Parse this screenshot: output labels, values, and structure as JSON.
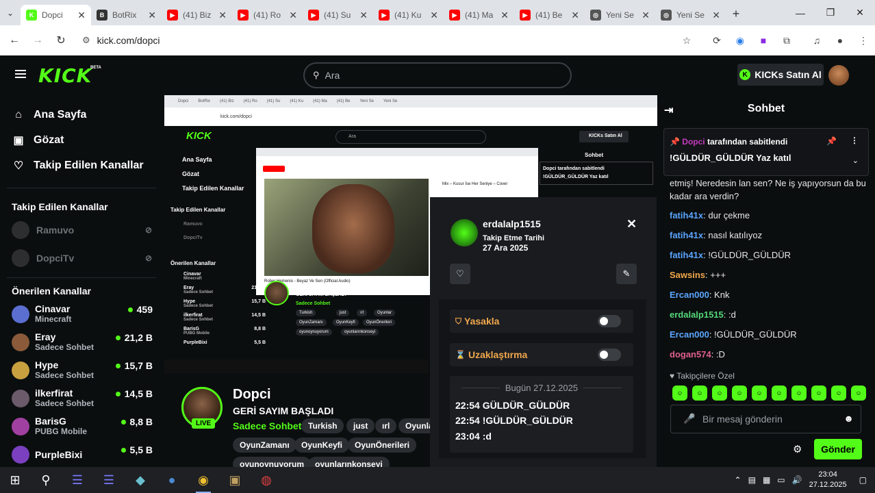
{
  "browser": {
    "tabs": [
      {
        "label": "Dopci",
        "fav_color": "#53fc18",
        "fav_text": "K",
        "active": true
      },
      {
        "label": "BotRix",
        "fav_color": "#333",
        "fav_text": "B"
      },
      {
        "label": "(41) Biz",
        "fav_color": "#ff0000",
        "fav_text": "▶"
      },
      {
        "label": "(41) Ro",
        "fav_color": "#ff0000",
        "fav_text": "▶"
      },
      {
        "label": "(41) Su",
        "fav_color": "#ff0000",
        "fav_text": "▶"
      },
      {
        "label": "(41) Ku",
        "fav_color": "#ff0000",
        "fav_text": "▶"
      },
      {
        "label": "(41) Ma",
        "fav_color": "#ff0000",
        "fav_text": "▶"
      },
      {
        "label": "(41) Be",
        "fav_color": "#ff0000",
        "fav_text": "▶"
      },
      {
        "label": "Yeni Se",
        "fav_color": "#555",
        "fav_text": "◎"
      },
      {
        "label": "Yeni Se",
        "fav_color": "#555",
        "fav_text": "◎"
      }
    ],
    "url": "kick.com/dopci"
  },
  "header": {
    "search_placeholder": "Ara",
    "kicks_button": "KICKs Satın Al",
    "beta_label": "BETA",
    "logo_text": "KICK"
  },
  "sidebar": {
    "nav": [
      {
        "label": "Ana Sayfa",
        "icon": "⌂"
      },
      {
        "label": "Gözat",
        "icon": "▣"
      },
      {
        "label": "Takip Edilen Kanallar",
        "icon": "♡"
      }
    ],
    "followed_heading": "Takip Edilen Kanallar",
    "followed": [
      {
        "name": "Ramuvo"
      },
      {
        "name": "DopciTv"
      }
    ],
    "recommended_heading": "Önerilen Kanallar",
    "recommended": [
      {
        "name": "Cinavar",
        "category": "Minecraft",
        "viewers": "459",
        "color": "#5b6fd1"
      },
      {
        "name": "Eray",
        "category": "Sadece Sohbet",
        "viewers": "21,2 B",
        "color": "#8a5a3a"
      },
      {
        "name": "Hype",
        "category": "Sadece Sohbet",
        "viewers": "15,7 B",
        "color": "#c8a040"
      },
      {
        "name": "ilkerfirat",
        "category": "Sadece Sohbet",
        "viewers": "14,5 B",
        "color": "#6a5a6a"
      },
      {
        "name": "BarisG",
        "category": "PUBG Mobile",
        "viewers": "8,8 B",
        "color": "#a040a0"
      },
      {
        "name": "PurpleBixi",
        "category": "",
        "viewers": "5,5 B",
        "color": "#7a40c0"
      }
    ]
  },
  "stream_mirror": {
    "url": "kick.com/dopci",
    "search": "Ara",
    "kicks": "KICKs Satın Al",
    "chat_title": "Sohbet",
    "pinned_user": "Dopci tarafından sabitlendi",
    "pinned_text": "!GÜLDÜR_GÜLDÜR Yaz katıl",
    "video_title": "Rober Hemenio - Beyaz Ve Sen (Official Audio)",
    "nav": [
      "Ana Sayfa",
      "Gözat",
      "Takip Edilen Kanallar"
    ],
    "followed_heading": "Takip Edilen Kanallar",
    "followed": [
      "Ramuvo",
      "DopciTv"
    ],
    "recommended_heading": "Önerilen Kanallar",
    "recommended": [
      {
        "name": "Cinavar",
        "category": "Minecraft",
        "viewers": "459"
      },
      {
        "name": "Eray",
        "category": "Sadece Sohbet",
        "viewers": "21,2 B"
      },
      {
        "name": "Hype",
        "category": "Sadece Sohbet",
        "viewers": "15,7 B"
      },
      {
        "name": "ilkerfirat",
        "category": "Sadece Sohbet",
        "viewers": "14,5 B"
      },
      {
        "name": "BarisG",
        "category": "PUBG Mobile",
        "viewers": "8,8 B"
      },
      {
        "name": "PurpleBixi",
        "category": "",
        "viewers": "5,5 B"
      }
    ],
    "streamer": "Dopci",
    "stream_title": "GERİ SAYIM BAŞLADI",
    "category": "Sadece Sohbet",
    "tags": [
      "Turkish",
      "just",
      "ırl",
      "Oyunlar",
      "OyunZamanı",
      "OyunKeyfi",
      "OyunÖnerileri",
      "oyunoynuyorum",
      "oyunlarınkonseyi"
    ]
  },
  "stream_info": {
    "streamer": "Dopci",
    "title": "GERİ SAYIM BAŞLADI",
    "category": "Sadece Sohbet",
    "live": "LIVE",
    "tags": [
      "Turkish",
      "just",
      "ırl",
      "Oyunlar",
      "OyunZamanı",
      "OyunKeyfi",
      "OyunÖnerileri",
      "oyunoynuyorum",
      "oyunlarınkonseyi"
    ]
  },
  "user_popup": {
    "username": "erdalalp1515",
    "follow_label": "Takip Etme Tarihi",
    "follow_date": "27 Ara 2025",
    "ban_label": "Yasakla",
    "timeout_label": "Uzaklaştırma",
    "today_label": "Bugün 27.12.2025",
    "messages": [
      "22:54 GÜLDÜR_GÜLDÜR",
      "22:54 !GÜLDÜR_GÜLDÜR",
      "23:04 :d"
    ]
  },
  "chat": {
    "title": "Sohbet",
    "pinned": {
      "user": "Dopci",
      "suffix": "tarafından sabitlendi",
      "text": "!GÜLDÜR_GÜLDÜR Yaz katıl"
    },
    "messages": [
      {
        "user": "",
        "text": "etmiş! Neredesin lan sen? Ne iş yapıyorsun da bu kadar ara verdin?",
        "color": "#e8e8e8"
      },
      {
        "user": "fatih41x",
        "text": ": dur çekme",
        "color": "#5aa5ff"
      },
      {
        "user": "fatih41x",
        "text": ": nasıl katılıyoz",
        "color": "#5aa5ff"
      },
      {
        "user": "fatih41x",
        "text": ": !GÜLDÜR_GÜLDÜR",
        "color": "#5aa5ff"
      },
      {
        "user": "Sawsins",
        "text": ": +++",
        "color": "#f2a84c"
      },
      {
        "user": "Ercan000",
        "text": ": Knk",
        "color": "#5aa5ff"
      },
      {
        "user": "erdalalp1515",
        "text": ": :d",
        "color": "#53d97a"
      },
      {
        "user": "Ercan000",
        "text": ": !GÜLDÜR_GÜLDÜR",
        "color": "#5aa5ff"
      },
      {
        "user": "dogan574",
        "text": ": :D",
        "color": "#e0608a"
      }
    ],
    "emote_heading": "Takipçilere Özel",
    "input_placeholder": "Bir mesaj gönderin",
    "send_label": "Gönder"
  },
  "taskbar": {
    "time": "23:04",
    "date": "27.12.2025"
  }
}
